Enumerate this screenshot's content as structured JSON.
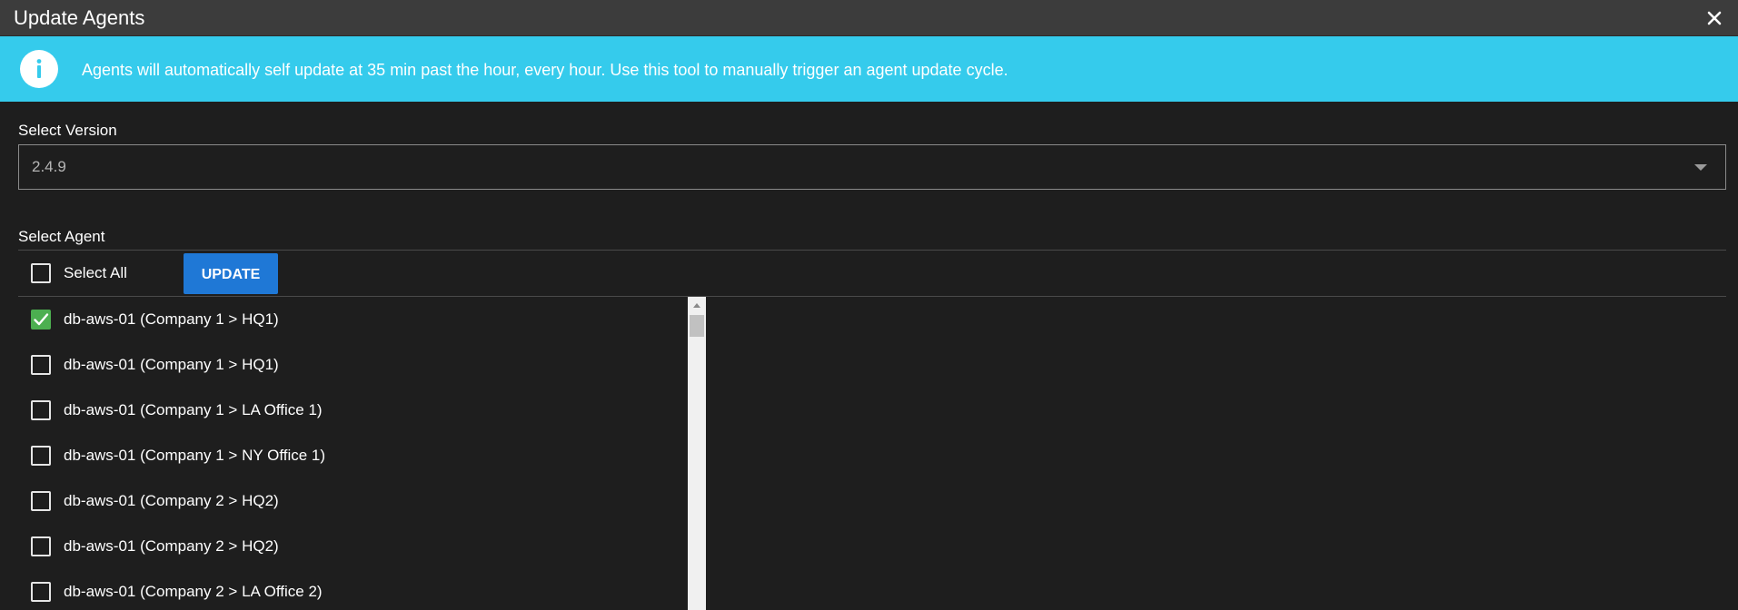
{
  "dialog": {
    "title": "Update Agents",
    "close_icon": "close-icon"
  },
  "info": {
    "icon": "info-icon",
    "message": "Agents will automatically self update at 35 min past the hour, every hour. Use this tool to manually trigger an agent update cycle.",
    "background_color": "#35cbec"
  },
  "version": {
    "label": "Select Version",
    "selected": "2.4.9"
  },
  "agent_select": {
    "label": "Select Agent",
    "select_all_label": "Select All",
    "select_all_checked": false,
    "update_label": "UPDATE",
    "update_color": "#1f78d6"
  },
  "agents": [
    {
      "label": "db-aws-01 (Company 1 > HQ1)",
      "checked": true
    },
    {
      "label": "db-aws-01 (Company 1 > HQ1)",
      "checked": false
    },
    {
      "label": "db-aws-01 (Company 1 > LA Office 1)",
      "checked": false
    },
    {
      "label": "db-aws-01 (Company 1 > NY Office 1)",
      "checked": false
    },
    {
      "label": "db-aws-01 (Company 2 > HQ2)",
      "checked": false
    },
    {
      "label": "db-aws-01 (Company 2 > HQ2)",
      "checked": false
    },
    {
      "label": "db-aws-01 (Company 2 > LA Office 2)",
      "checked": false
    }
  ],
  "colors": {
    "check_green": "#4caf50"
  }
}
